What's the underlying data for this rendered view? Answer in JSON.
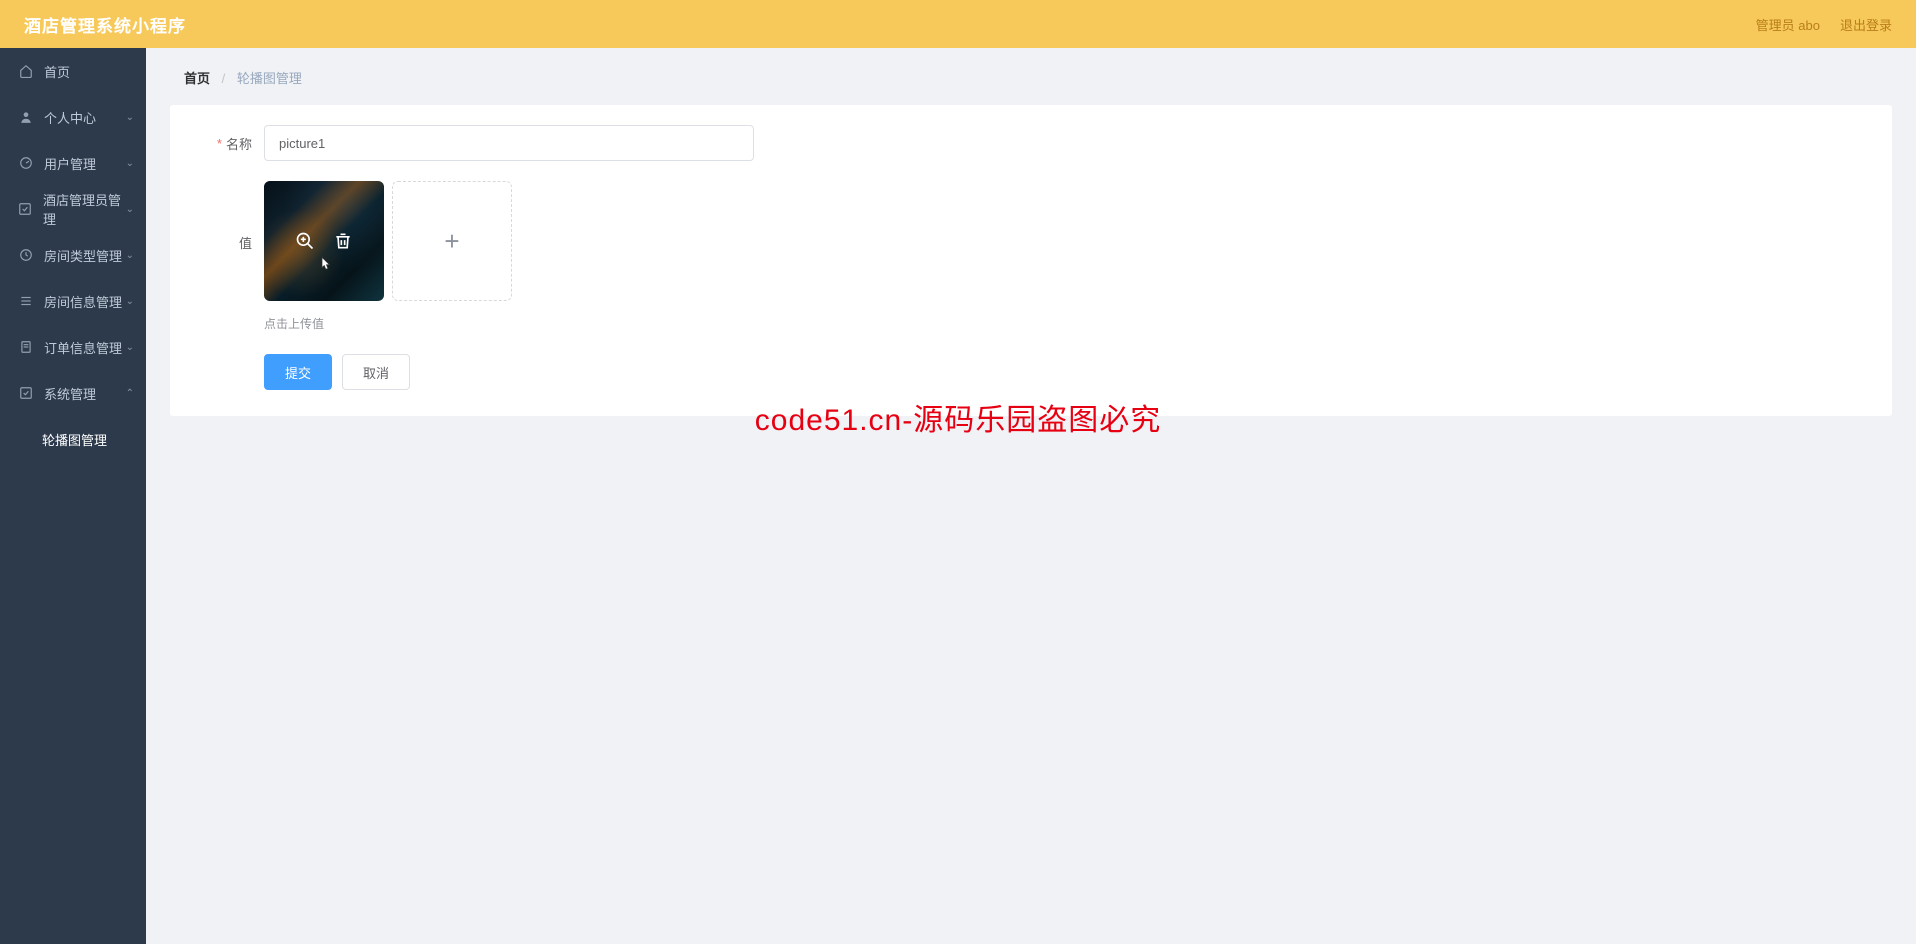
{
  "header": {
    "title": "酒店管理系统小程序",
    "user_label": "管理员 abo",
    "logout": "退出登录"
  },
  "sidebar": {
    "items": [
      {
        "label": "首页",
        "icon": "home",
        "expandable": false
      },
      {
        "label": "个人中心",
        "icon": "user",
        "expandable": true
      },
      {
        "label": "用户管理",
        "icon": "gauge",
        "expandable": true
      },
      {
        "label": "酒店管理员管理",
        "icon": "check-square",
        "expandable": true
      },
      {
        "label": "房间类型管理",
        "icon": "clock",
        "expandable": true
      },
      {
        "label": "房间信息管理",
        "icon": "list",
        "expandable": true
      },
      {
        "label": "订单信息管理",
        "icon": "file",
        "expandable": true
      },
      {
        "label": "系统管理",
        "icon": "check-square",
        "expandable": true,
        "expanded": true
      }
    ],
    "sub_item": {
      "label": "轮播图管理"
    }
  },
  "breadcrumb": {
    "home": "首页",
    "current": "轮播图管理"
  },
  "form": {
    "name_label": "名称",
    "name_value": "picture1",
    "value_label": "值",
    "hint": "点击上传值",
    "submit": "提交",
    "cancel": "取消"
  },
  "watermark": {
    "text": "code51.cn",
    "center": "code51.cn-源码乐园盗图必究"
  }
}
